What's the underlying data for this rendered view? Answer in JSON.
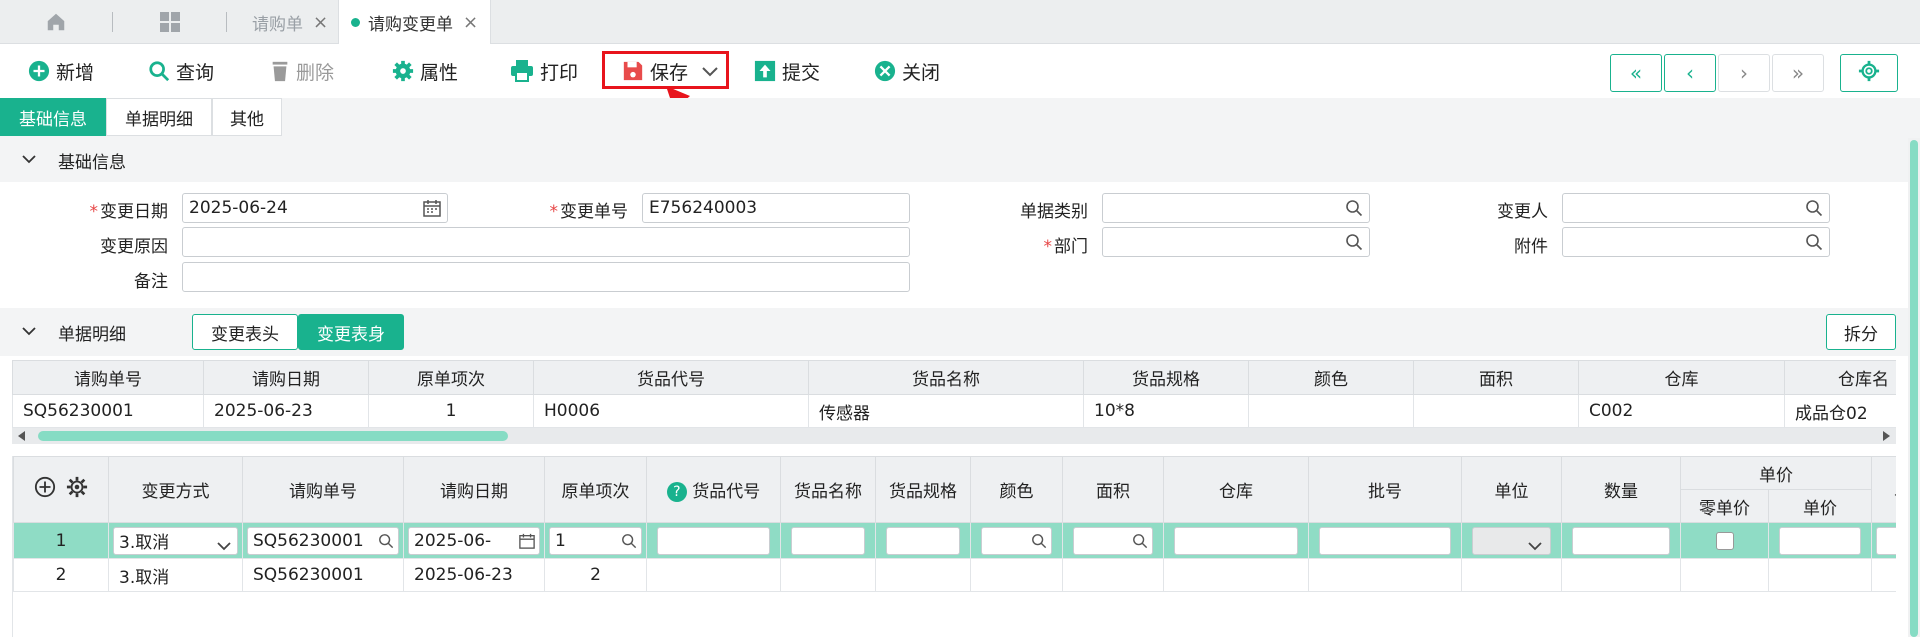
{
  "tabs": {
    "home_label": "",
    "apps_label": "",
    "items": [
      {
        "label": "请购单",
        "close": "×"
      },
      {
        "label": "请购变更单",
        "close": "×"
      }
    ]
  },
  "toolbar": {
    "add": "新增",
    "query": "查询",
    "delete": "删除",
    "attr": "属性",
    "print": "打印",
    "save": "保存",
    "submit": "提交",
    "close": "关闭"
  },
  "nav": {
    "first": "«",
    "prev": "‹",
    "next": "›",
    "last": "»"
  },
  "page_tabs": [
    "基础信息",
    "单据明细",
    "其他"
  ],
  "basic": {
    "section_title": "基础信息",
    "change_date_label": "变更日期",
    "change_date": "2025-06-24",
    "change_no_label": "变更单号",
    "change_no": "E756240003",
    "doc_type_label": "单据类别",
    "doc_type": "",
    "changer_label": "变更人",
    "changer": "",
    "reason_label": "变更原因",
    "reason": "",
    "dept_label": "部门",
    "dept": "",
    "attach_label": "附件",
    "attach": "",
    "remark_label": "备注",
    "remark": ""
  },
  "detail": {
    "section_title": "单据明细",
    "btn_head": "变更表头",
    "btn_body": "变更表身",
    "btn_split": "拆分",
    "top_columns": [
      "请购单号",
      "请购日期",
      "原单项次",
      "货品代号",
      "货品名称",
      "货品规格",
      "颜色",
      "面积",
      "仓库",
      "仓库名"
    ],
    "top_rows": [
      [
        "SQ56230001",
        "2025-06-23",
        "1",
        "H0006",
        "传感器",
        "10*8",
        "",
        "",
        "C002",
        "成品仓02"
      ]
    ],
    "bottom_columns": [
      "变更方式",
      "请购单号",
      "请购日期",
      "原单项次",
      "货品代号",
      "货品名称",
      "货品规格",
      "颜色",
      "面积",
      "仓库",
      "批号",
      "单位",
      "数量",
      "单价",
      "零单价",
      "单价",
      "单"
    ],
    "edit_row": {
      "seq": "1",
      "mode": "3.取消",
      "no": "SQ56230001",
      "date": "2025-06-",
      "item": "1"
    },
    "row2": {
      "seq": "2",
      "mode": "3.取消",
      "no": "SQ56230001",
      "date": "2025-06-23",
      "item": "2"
    }
  }
}
